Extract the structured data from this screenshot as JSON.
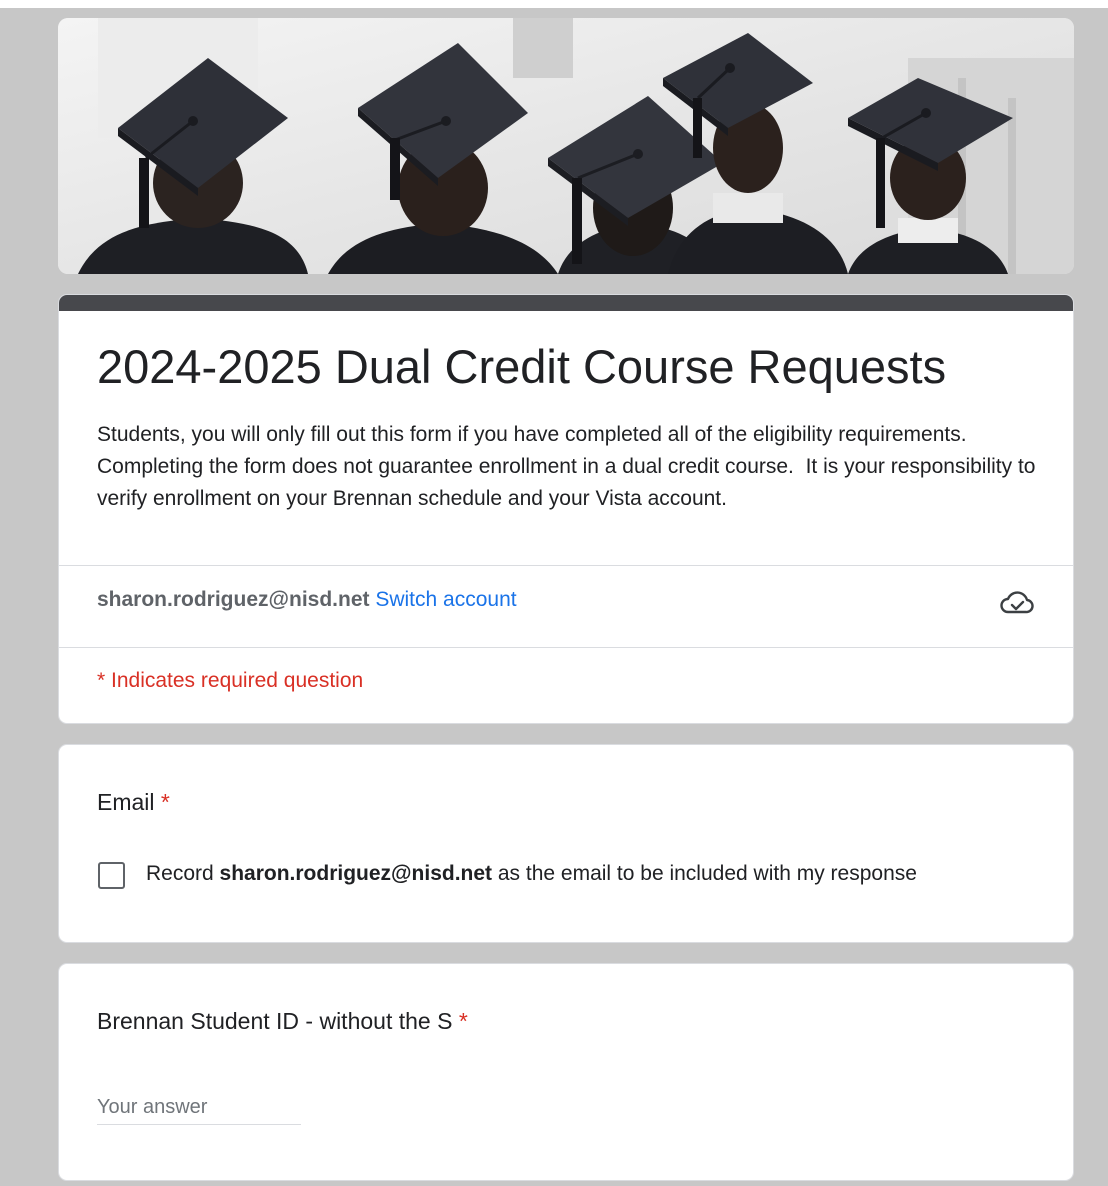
{
  "form": {
    "title": "2024-2025 Dual Credit Course Requests",
    "description": "Students, you will only fill out this form if you have completed all of the eligibility requirements.  Completing the form does not guarantee enrollment in a dual credit course.  It is your responsibility to verify enrollment on your Brennan schedule and your Vista account.",
    "account_email": "sharon.rodriguez@nisd.net",
    "switch_account_label": "Switch account",
    "save_status_icon": "cloud-check-icon",
    "required_note": "* Indicates required question"
  },
  "questions": [
    {
      "title": "Email",
      "required_marker": "*",
      "checkbox_prefix": "Record ",
      "checkbox_email": "sharon.rodriguez@nisd.net",
      "checkbox_suffix": " as the email to be included with my response",
      "checked": false
    },
    {
      "title": "Brennan Student ID - without the S",
      "required_marker": "*",
      "value": "",
      "placeholder": "Your answer"
    }
  ],
  "colors": {
    "accent_bar": "#47484c",
    "link": "#1a73e8",
    "required": "#d93025",
    "page_background": "#c7c7c7"
  }
}
